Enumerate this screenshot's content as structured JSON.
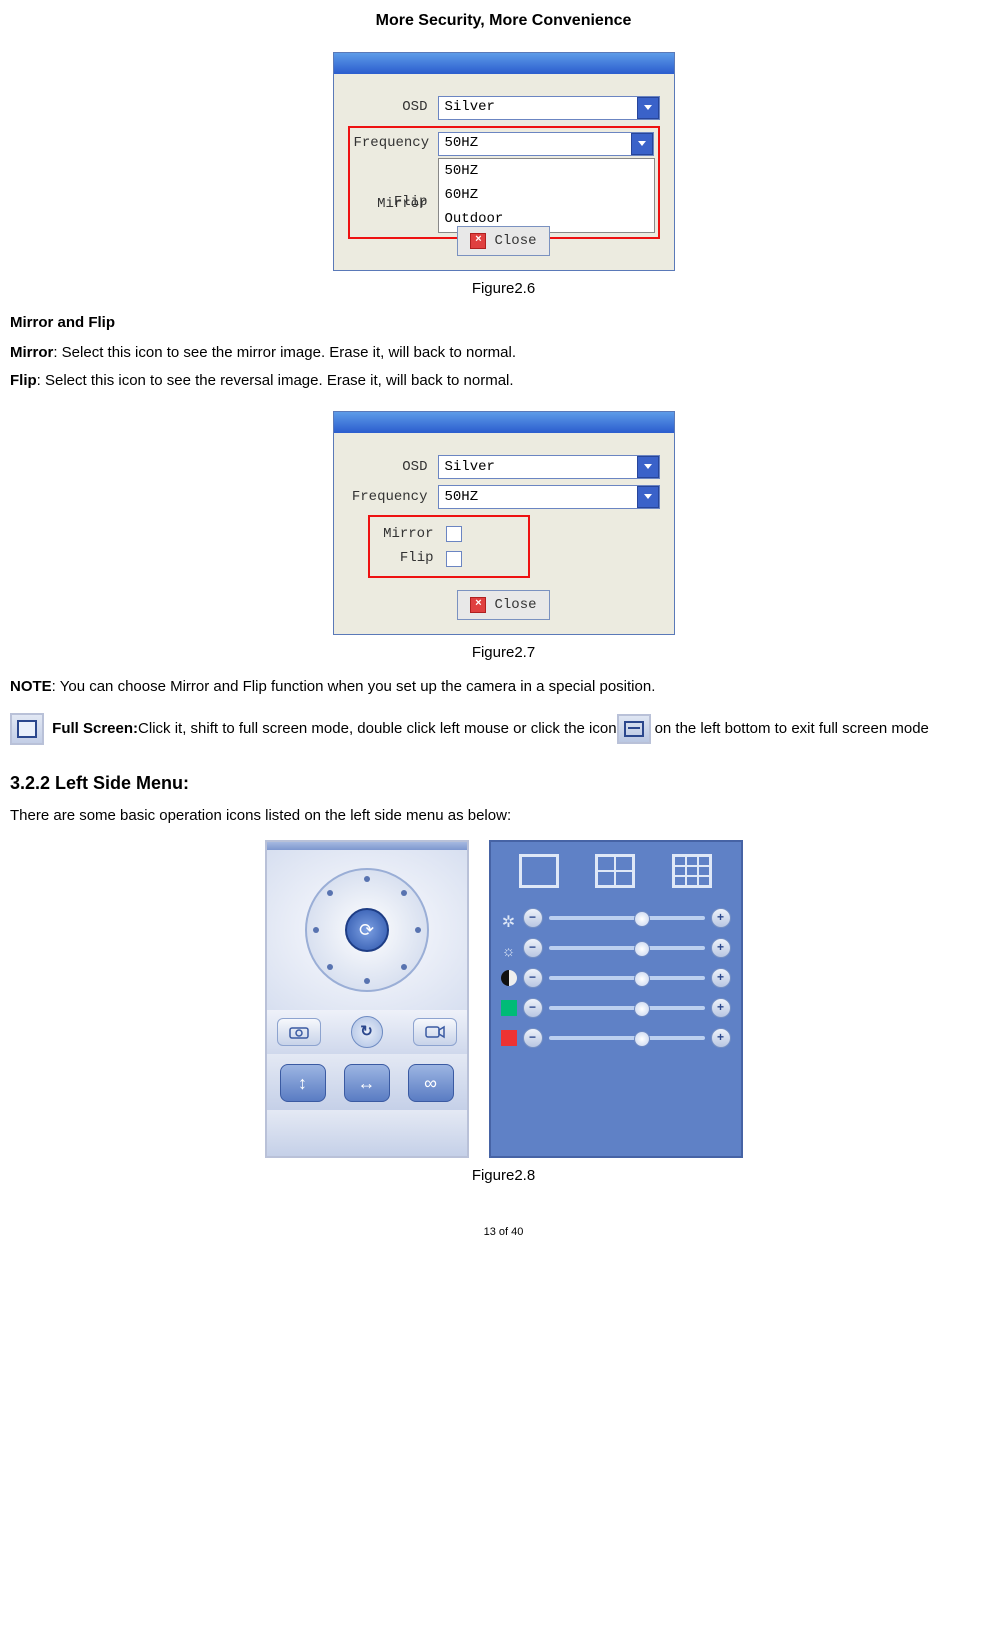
{
  "header": {
    "title": "More Security, More Convenience"
  },
  "figure26": {
    "caption": "Figure2.6",
    "labels": {
      "osd": "OSD",
      "frequency": "Frequency",
      "mirror": "Mirror",
      "flip": "Flip"
    },
    "osd_value": "Silver",
    "freq_value": "50HZ",
    "options": [
      "50HZ",
      "60HZ",
      "Outdoor"
    ],
    "close": "Close"
  },
  "section_mirrorflip": {
    "heading": "Mirror and Flip",
    "mirror_label": "Mirror",
    "mirror_text": ": Select this icon to see the mirror image. Erase it, will back to normal.",
    "flip_label": "Flip",
    "flip_text": ": Select this icon to see the reversal image. Erase it, will back to normal."
  },
  "figure27": {
    "caption": "Figure2.7",
    "labels": {
      "osd": "OSD",
      "frequency": "Frequency",
      "mirror": "Mirror",
      "flip": "Flip"
    },
    "osd_value": "Silver",
    "freq_value": "50HZ",
    "close": "Close"
  },
  "note": {
    "label": "NOTE",
    "text": ": You can choose Mirror and Flip function when you set up the camera in a special position."
  },
  "fullscreen": {
    "label": "Full Screen:",
    "text1": " Click it, shift to full screen mode, double click left mouse or click the icon",
    "text2": " on the left bottom to exit full screen mode"
  },
  "section322": {
    "heading": "3.2.2 Left Side Menu:",
    "intro": "There are some basic operation icons listed on the left side menu as below:"
  },
  "figure28": {
    "caption": "Figure2.8"
  },
  "footer": {
    "pagenum": "13 of 40"
  }
}
